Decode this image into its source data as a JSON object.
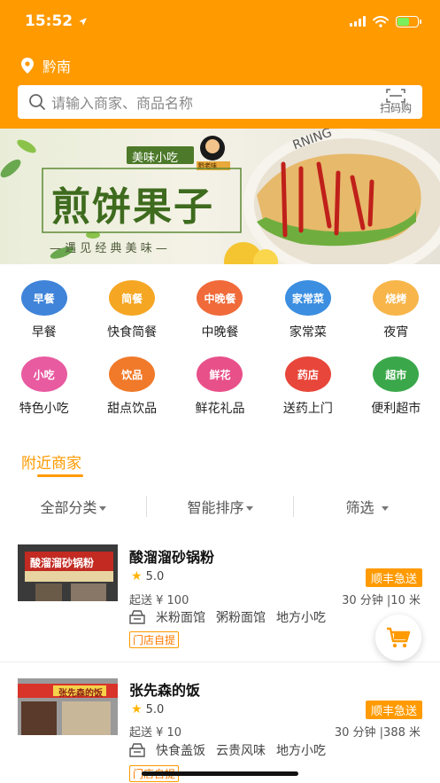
{
  "status": {
    "time": "15:52"
  },
  "location": {
    "city": "黔南"
  },
  "search": {
    "placeholder": "请输入商家、商品名称",
    "scan_label": "扫码购"
  },
  "banner": {
    "tag": "美味小吃",
    "brand_line1": "黔老味",
    "brand_line2": "熊爸爸小吃",
    "title": "煎饼果子",
    "subtitle": "— 遇 见 经 典 美 味 —",
    "cup_text": "RNING",
    "side_text": "美味"
  },
  "categories": [
    {
      "icon_text": "早餐",
      "label": "早餐",
      "color": "#3f84d9"
    },
    {
      "icon_text": "简餐",
      "label": "快食简餐",
      "color": "#f5a623"
    },
    {
      "icon_text": "中晚餐",
      "label": "中晚餐",
      "color": "#f06a3a"
    },
    {
      "icon_text": "家常菜",
      "label": "家常菜",
      "color": "#3b8ee0"
    },
    {
      "icon_text": "烧烤",
      "label": "夜宵",
      "color": "#f7b54a"
    },
    {
      "icon_text": "小吃",
      "label": "特色小吃",
      "color": "#e85ba0"
    },
    {
      "icon_text": "饮品",
      "label": "甜点饮品",
      "color": "#f07a2a"
    },
    {
      "icon_text": "鲜花",
      "label": "鲜花礼品",
      "color": "#e8508a"
    },
    {
      "icon_text": "药店",
      "label": "送药上门",
      "color": "#e8463a"
    },
    {
      "icon_text": "超市",
      "label": "便利超市",
      "color": "#3aa84a"
    }
  ],
  "nearby": {
    "title": "附近商家"
  },
  "filters": [
    {
      "label": "全部分类"
    },
    {
      "label": "智能排序"
    },
    {
      "label": "筛选"
    }
  ],
  "shops": [
    {
      "name": "酸溜溜砂锅粉",
      "rating": "5.0",
      "min_order": "起送 ¥ 100",
      "eta": "30 分钟 |10 米",
      "delivery_badge": "顺丰急送",
      "tags": [
        "米粉面馆",
        "粥粉面馆",
        "地方小吃"
      ],
      "self_pickup": "门店自提",
      "sign_text": "酸溜溜砂锅粉"
    },
    {
      "name": "张先森的饭",
      "rating": "5.0",
      "min_order": "起送 ¥ 10",
      "eta": "30 分钟 |388 米",
      "delivery_badge": "顺丰急送",
      "tags": [
        "快食盖饭",
        "云贵风味",
        "地方小吃"
      ],
      "self_pickup": "门店自提",
      "sign_text": "张先森的饭"
    }
  ]
}
